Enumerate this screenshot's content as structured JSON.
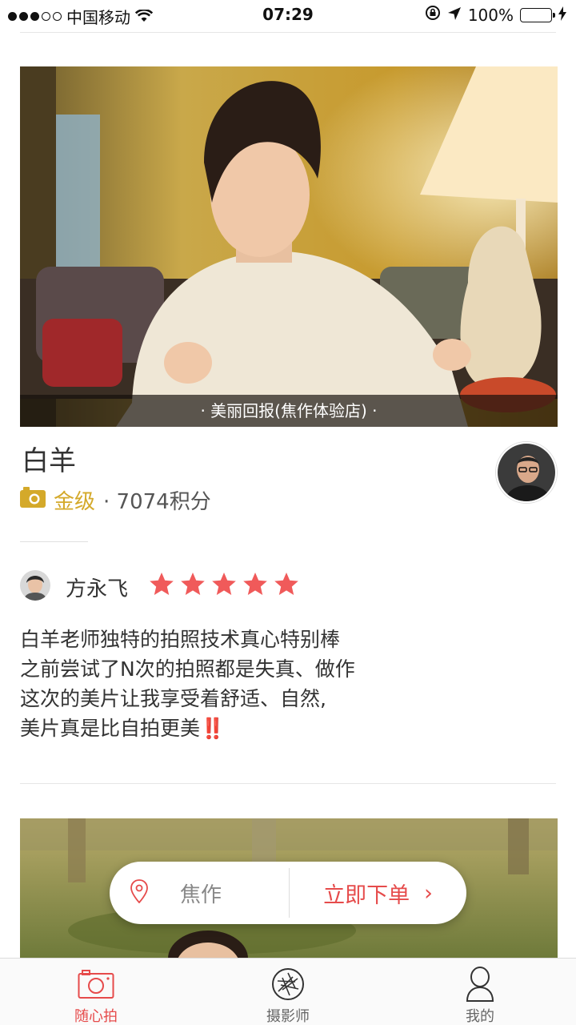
{
  "status_bar": {
    "carrier": "中国移动",
    "time": "07:29",
    "battery": "100%",
    "battery_level": 1.0
  },
  "studio": {
    "caption": "· 美丽回报(焦作体验店) ·",
    "photographer_name": "白羊",
    "level": "金级",
    "points": "· 7074积分"
  },
  "review": {
    "reviewer_name": "方永飞",
    "rating": 5,
    "lines": [
      "白羊老师独特的拍照技术真心特别棒",
      "之前尝试了N次的拍照都是失真、做作",
      "这次的美片让我享受着舒适、自然,",
      "美片真是比自拍更美"
    ],
    "emphasis": "‼️"
  },
  "order_bar": {
    "location": "焦作",
    "action": "立即下单",
    "action_chevron": "›"
  },
  "tabbar": {
    "items": [
      {
        "label": "随心拍",
        "icon": "camera-icon",
        "active": true
      },
      {
        "label": "摄影师",
        "icon": "aperture-icon",
        "active": false
      },
      {
        "label": "我的",
        "icon": "person-icon",
        "active": false
      }
    ]
  },
  "colors": {
    "accent": "#e64b4b",
    "gold": "#d4a92a",
    "star": "#f05a5a"
  }
}
